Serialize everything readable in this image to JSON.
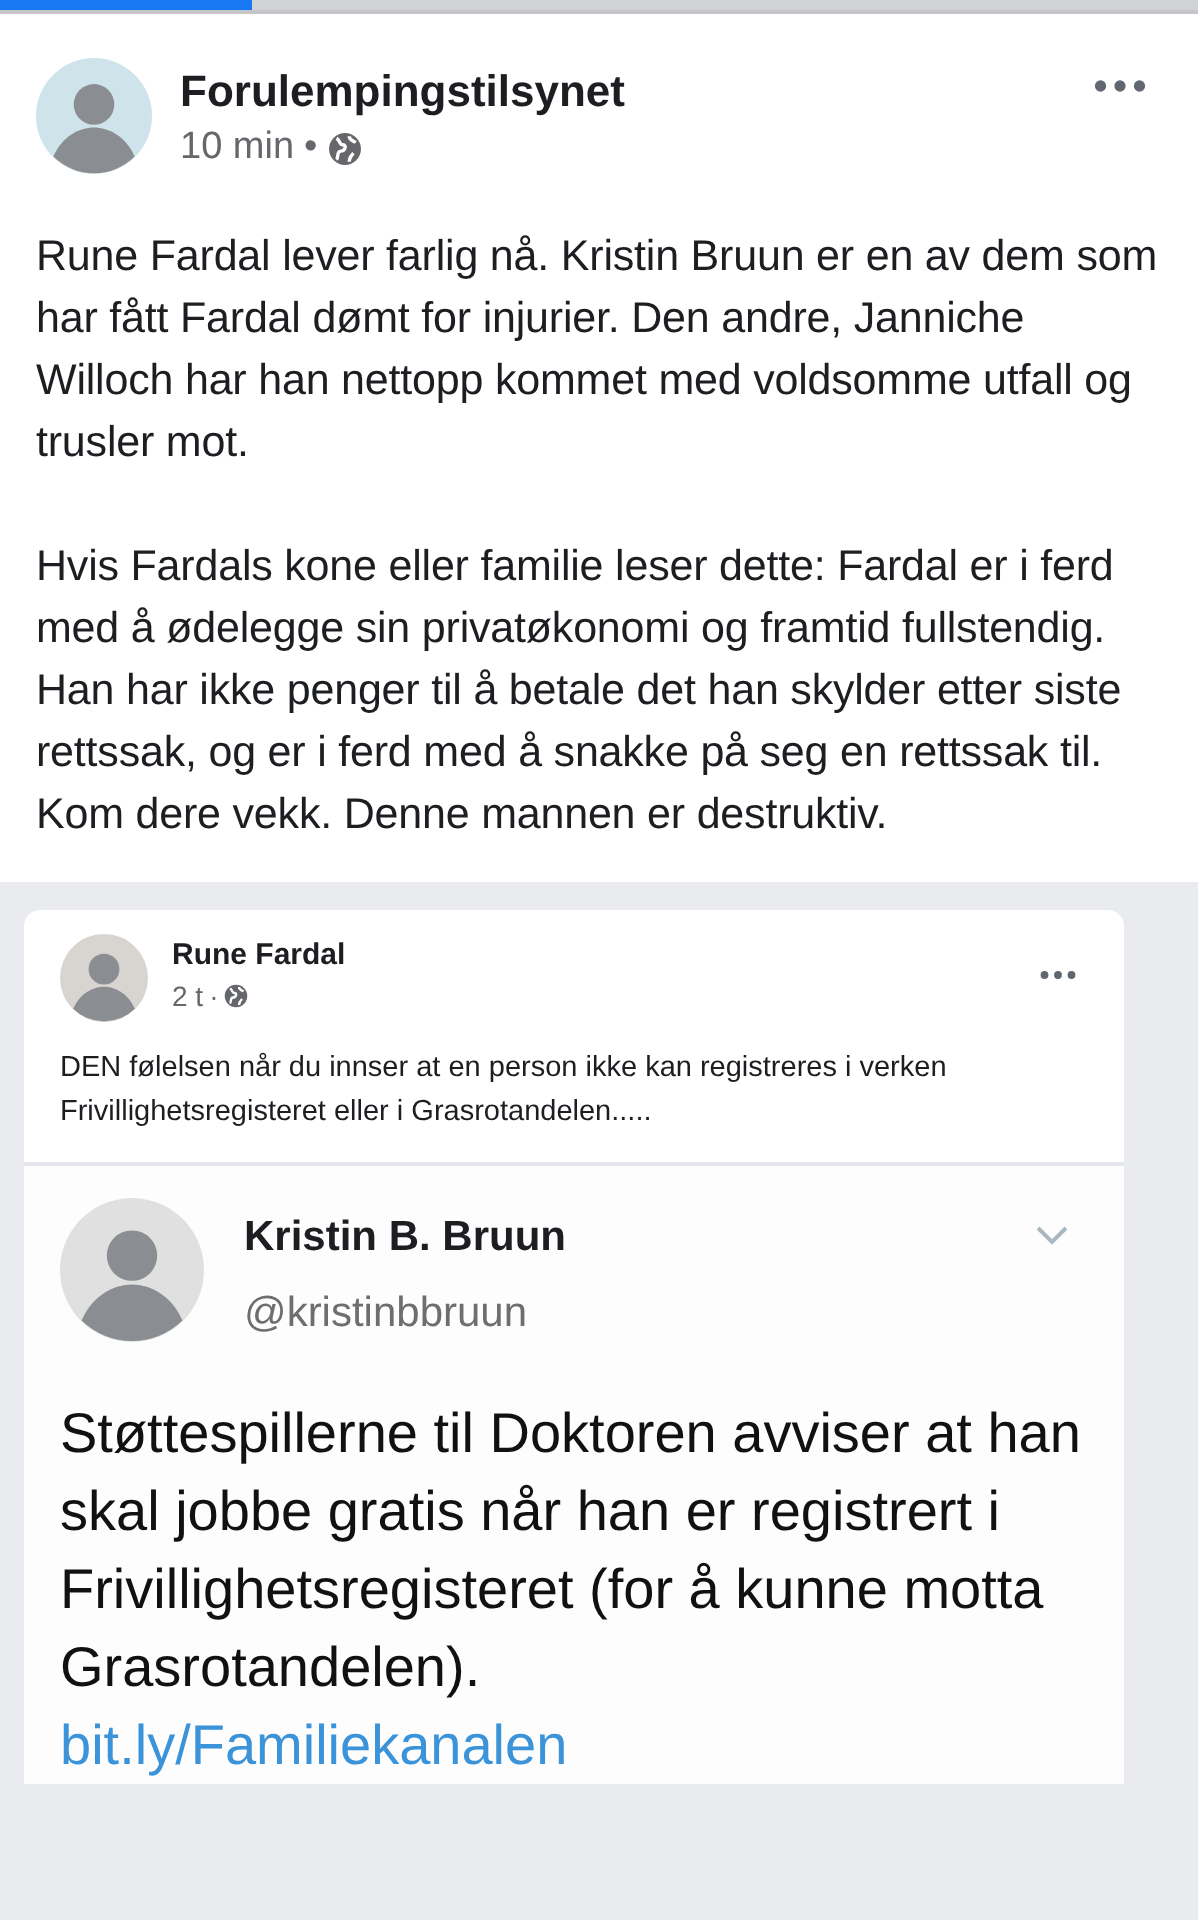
{
  "loading_bar": {
    "level": 0.21
  },
  "post": {
    "author": "Forulempingstilsynet",
    "time": "10 min",
    "separator": "•",
    "paragraphs": [
      "Rune Fardal lever farlig nå. Kristin Bruun er en av dem som har fått Fardal dømt for injurier. Den andre, Janniche Willoch har han nettopp kommet med voldsomme utfall og trusler mot.",
      "Hvis Fardals kone eller familie leser dette: Fardal er i ferd med å ødelegge sin privatøkonomi og framtid fullstendig. Han har ikke penger til å betale det han skylder etter siste rettssak, og er i ferd med å snakke på seg en rettssak til. Kom dere vekk. Denne mannen er destruktiv."
    ]
  },
  "shared_post": {
    "author": "Rune Fardal",
    "time": "2 t",
    "separator": "·",
    "text": "DEN følelsen når du innser at en person ikke kan registreres i verken Frivillighetsregisteret eller i Grasrotandelen.....",
    "tweet": {
      "name": "Kristin B. Bruun",
      "handle": "@kristinbbruun",
      "text": "Støttespillerne til Doktoren avviser at han skal jobbe gratis når han er registrert i Frivillighetsregisteret (for å kunne motta Grasrotandelen).",
      "link": "bit.ly/Familiekanalen"
    }
  }
}
